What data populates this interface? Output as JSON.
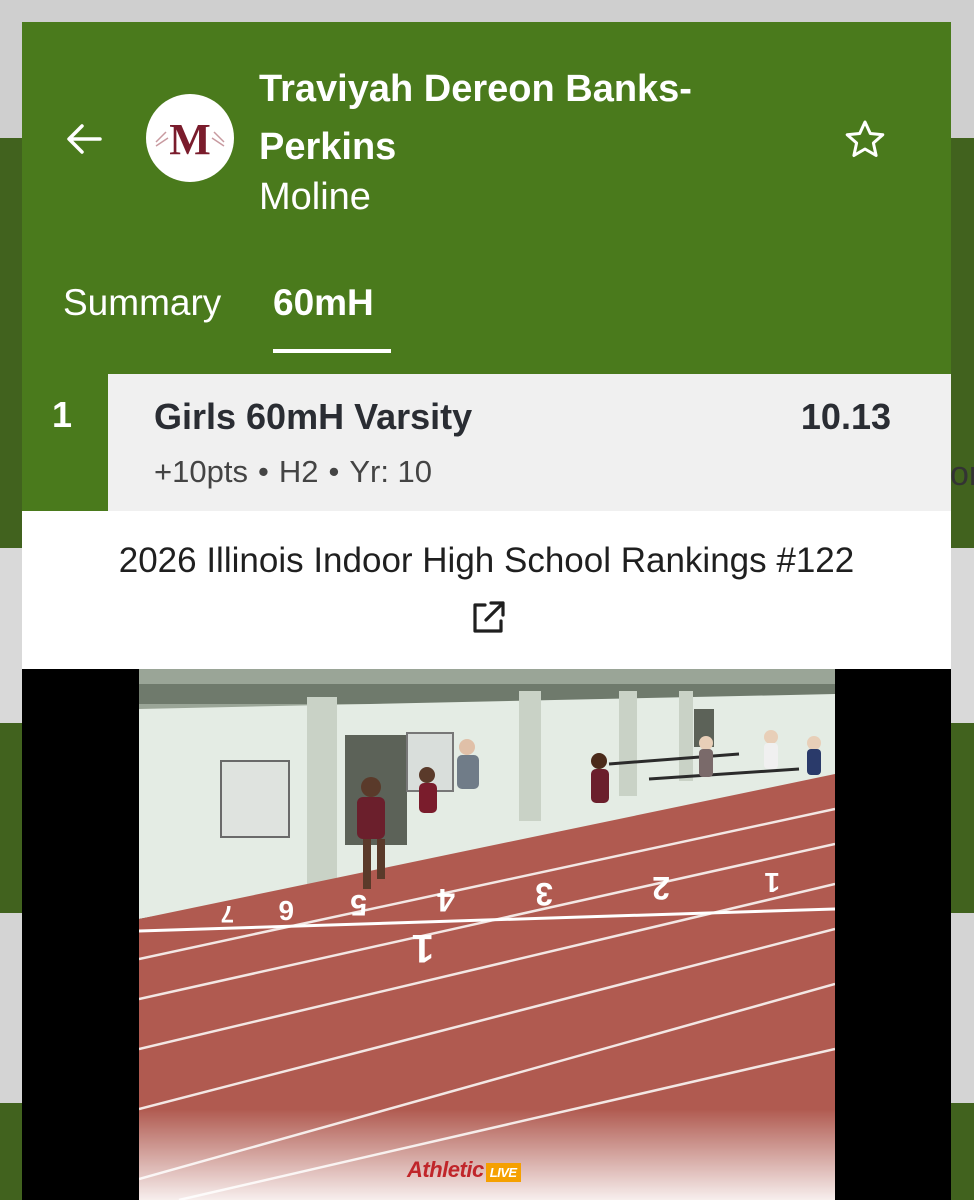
{
  "athlete": {
    "name": "Traviyah Dereon Banks-Perkins",
    "school": "Moline",
    "logo_letter": "M"
  },
  "tabs": [
    {
      "label": "Summary",
      "active": false
    },
    {
      "label": "60mH",
      "active": true
    }
  ],
  "result": {
    "place": "1",
    "event": "Girls 60mH Varsity",
    "mark": "10.13",
    "points": "+10pts",
    "heat": "H2",
    "year": "Yr: 10",
    "separator": "•"
  },
  "ranking": {
    "text": "2026 Illinois Indoor High School Rankings #122"
  },
  "video": {
    "brand": "Athletic",
    "brand_tag": "LIVE"
  },
  "background_peek": "or",
  "colors": {
    "header_green": "#4a7a1c",
    "page_green": "#41621e",
    "track_red": "#b05a50",
    "logo_maroon": "#7a1c2c"
  },
  "icons": {
    "back": "arrow-left-icon",
    "favorite": "star-outline-icon",
    "external": "external-link-icon"
  }
}
